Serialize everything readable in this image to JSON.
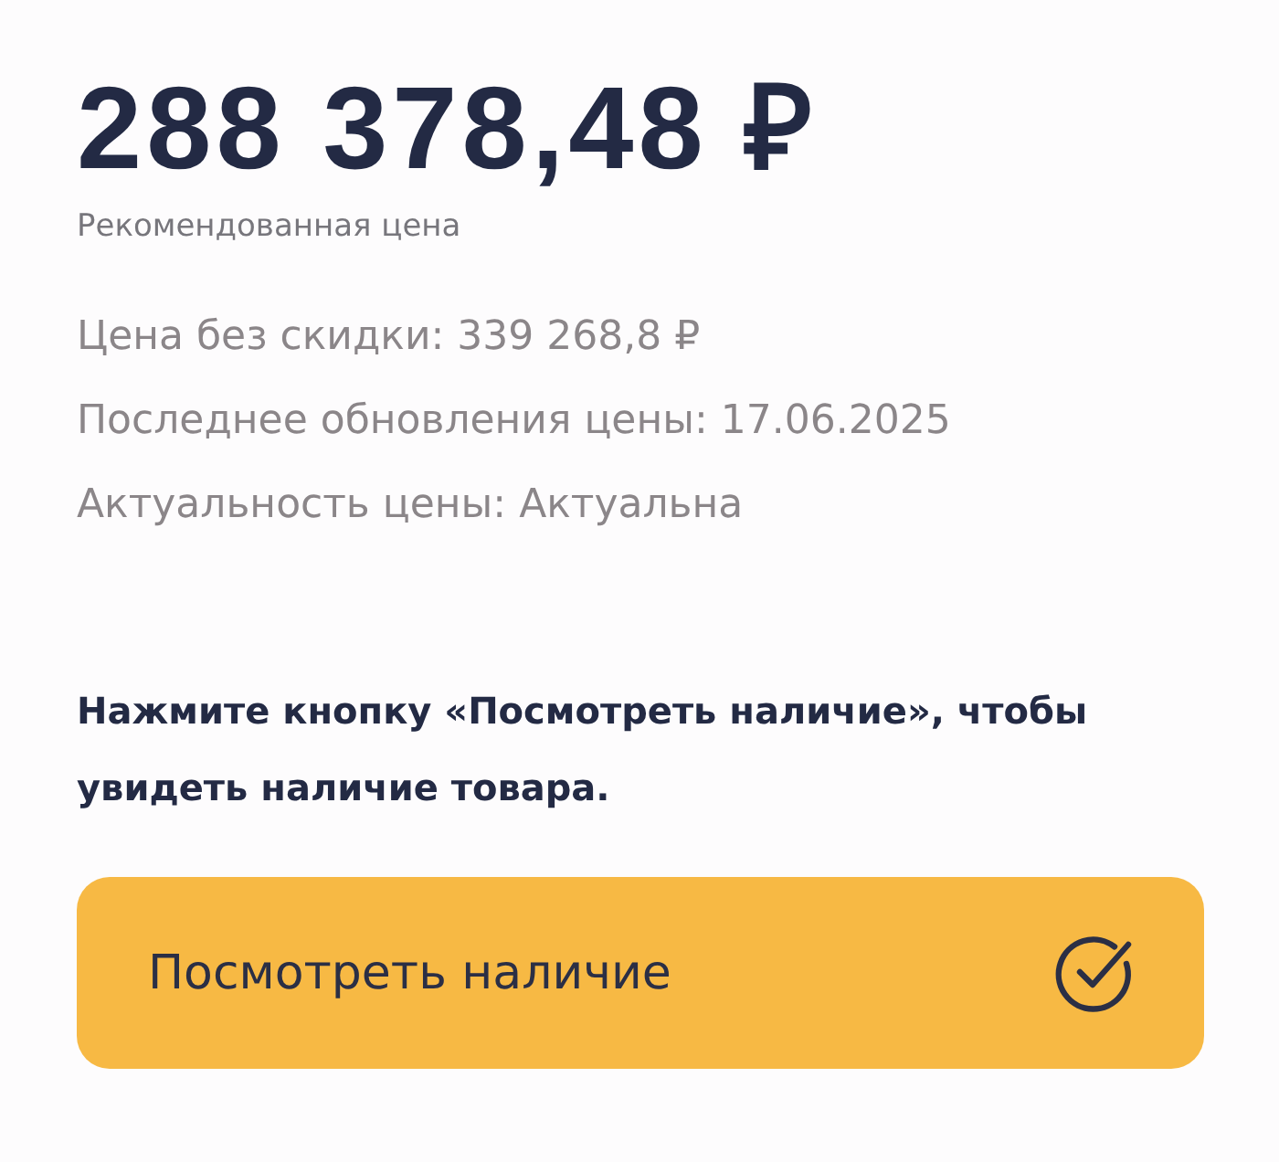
{
  "price": {
    "amount": "288 378,48 ₽",
    "caption": "Рекомендованная цена"
  },
  "details": [
    "Цена без скидки: 339 268,8 ₽",
    "Последнее обновления цены: 17.06.2025",
    "Актуальность цены: Актуальна"
  ],
  "notice": "Нажмите кнопку «Посмотреть наличие», чтобы увидеть наличие товара.",
  "button": {
    "label": "Посмотреть наличие"
  }
}
